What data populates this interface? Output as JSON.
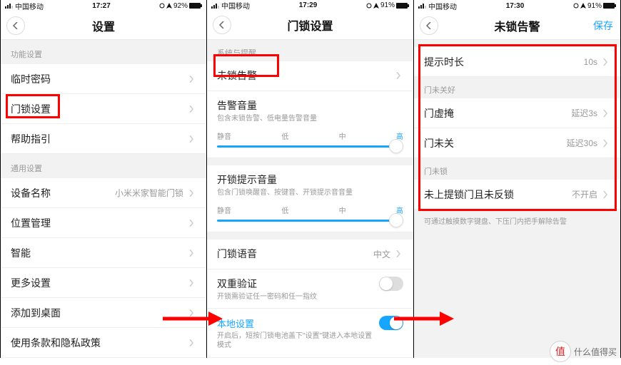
{
  "status": {
    "carrier": "中国移动",
    "battery": "92%",
    "battery2": "91%",
    "battery3": "91%",
    "time1": "17:27",
    "time2": "17:29",
    "time3": "17:30"
  },
  "screen1": {
    "title": "设置",
    "sections": {
      "func": "功能设置",
      "general": "通用设置"
    },
    "items": {
      "temp_pwd": "临时密码",
      "lock_settings": "门锁设置",
      "help": "帮助指引",
      "device_name": "设备名称",
      "device_name_value": "小米米家智能门锁",
      "location": "位置管理",
      "smart": "智能",
      "more": "更多设置",
      "add_home": "添加到桌面",
      "terms": "使用条款和隐私政策"
    }
  },
  "screen2": {
    "title": "门锁设置",
    "section": "系统与提醒",
    "items": {
      "unlock_alarm": "未锁告警",
      "alarm_vol": "告警音量",
      "alarm_vol_desc": "包含未锁告警、低电量告警音量",
      "unlock_tip_vol": "开锁提示音量",
      "unlock_tip_desc": "包含门锁唤醒音、按键音、开锁提示音音量",
      "lang": "门锁语音",
      "lang_value": "中文",
      "dual_auth": "双重验证",
      "dual_auth_desc": "开锁需验证任一密码和任一指纹",
      "local": "本地设置",
      "local_desc": "开启后，短按门锁电池盖下\"设置\"键进入本地设置模式"
    },
    "slider": {
      "l0": "静音",
      "l1": "低",
      "l2": "中",
      "l3": "高"
    }
  },
  "screen3": {
    "title": "未锁告警",
    "save": "保存",
    "items": {
      "duration": "提示时长",
      "duration_value": "10s",
      "section_not_closed": "门未关好",
      "ajar": "门虚掩",
      "ajar_value": "延迟3s",
      "not_closed": "门未关",
      "not_closed_value": "延迟30s",
      "section_not_locked": "门未锁",
      "not_lifted": "未上提锁门且未反锁",
      "not_lifted_value": "不开启"
    },
    "note": "可通过触摸数字键盘、下压门内把手解除告警"
  },
  "watermark": {
    "symbol": "值",
    "text": "什么值得买"
  }
}
